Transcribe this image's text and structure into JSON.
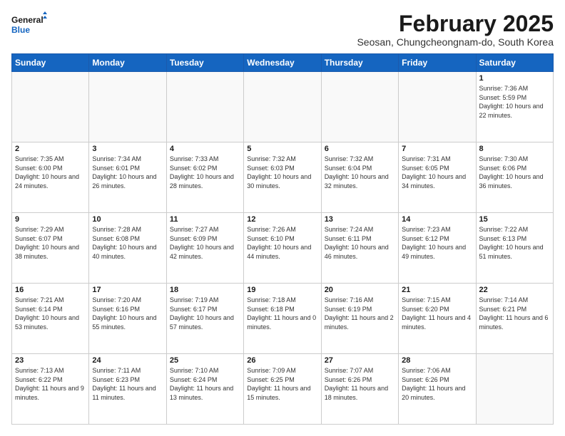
{
  "header": {
    "logo_line1": "General",
    "logo_line2": "Blue",
    "main_title": "February 2025",
    "subtitle": "Seosan, Chungcheongnam-do, South Korea"
  },
  "days_of_week": [
    "Sunday",
    "Monday",
    "Tuesday",
    "Wednesday",
    "Thursday",
    "Friday",
    "Saturday"
  ],
  "weeks": [
    [
      {
        "day": "",
        "info": ""
      },
      {
        "day": "",
        "info": ""
      },
      {
        "day": "",
        "info": ""
      },
      {
        "day": "",
        "info": ""
      },
      {
        "day": "",
        "info": ""
      },
      {
        "day": "",
        "info": ""
      },
      {
        "day": "1",
        "info": "Sunrise: 7:36 AM\nSunset: 5:59 PM\nDaylight: 10 hours and 22 minutes."
      }
    ],
    [
      {
        "day": "2",
        "info": "Sunrise: 7:35 AM\nSunset: 6:00 PM\nDaylight: 10 hours and 24 minutes."
      },
      {
        "day": "3",
        "info": "Sunrise: 7:34 AM\nSunset: 6:01 PM\nDaylight: 10 hours and 26 minutes."
      },
      {
        "day": "4",
        "info": "Sunrise: 7:33 AM\nSunset: 6:02 PM\nDaylight: 10 hours and 28 minutes."
      },
      {
        "day": "5",
        "info": "Sunrise: 7:32 AM\nSunset: 6:03 PM\nDaylight: 10 hours and 30 minutes."
      },
      {
        "day": "6",
        "info": "Sunrise: 7:32 AM\nSunset: 6:04 PM\nDaylight: 10 hours and 32 minutes."
      },
      {
        "day": "7",
        "info": "Sunrise: 7:31 AM\nSunset: 6:05 PM\nDaylight: 10 hours and 34 minutes."
      },
      {
        "day": "8",
        "info": "Sunrise: 7:30 AM\nSunset: 6:06 PM\nDaylight: 10 hours and 36 minutes."
      }
    ],
    [
      {
        "day": "9",
        "info": "Sunrise: 7:29 AM\nSunset: 6:07 PM\nDaylight: 10 hours and 38 minutes."
      },
      {
        "day": "10",
        "info": "Sunrise: 7:28 AM\nSunset: 6:08 PM\nDaylight: 10 hours and 40 minutes."
      },
      {
        "day": "11",
        "info": "Sunrise: 7:27 AM\nSunset: 6:09 PM\nDaylight: 10 hours and 42 minutes."
      },
      {
        "day": "12",
        "info": "Sunrise: 7:26 AM\nSunset: 6:10 PM\nDaylight: 10 hours and 44 minutes."
      },
      {
        "day": "13",
        "info": "Sunrise: 7:24 AM\nSunset: 6:11 PM\nDaylight: 10 hours and 46 minutes."
      },
      {
        "day": "14",
        "info": "Sunrise: 7:23 AM\nSunset: 6:12 PM\nDaylight: 10 hours and 49 minutes."
      },
      {
        "day": "15",
        "info": "Sunrise: 7:22 AM\nSunset: 6:13 PM\nDaylight: 10 hours and 51 minutes."
      }
    ],
    [
      {
        "day": "16",
        "info": "Sunrise: 7:21 AM\nSunset: 6:14 PM\nDaylight: 10 hours and 53 minutes."
      },
      {
        "day": "17",
        "info": "Sunrise: 7:20 AM\nSunset: 6:16 PM\nDaylight: 10 hours and 55 minutes."
      },
      {
        "day": "18",
        "info": "Sunrise: 7:19 AM\nSunset: 6:17 PM\nDaylight: 10 hours and 57 minutes."
      },
      {
        "day": "19",
        "info": "Sunrise: 7:18 AM\nSunset: 6:18 PM\nDaylight: 11 hours and 0 minutes."
      },
      {
        "day": "20",
        "info": "Sunrise: 7:16 AM\nSunset: 6:19 PM\nDaylight: 11 hours and 2 minutes."
      },
      {
        "day": "21",
        "info": "Sunrise: 7:15 AM\nSunset: 6:20 PM\nDaylight: 11 hours and 4 minutes."
      },
      {
        "day": "22",
        "info": "Sunrise: 7:14 AM\nSunset: 6:21 PM\nDaylight: 11 hours and 6 minutes."
      }
    ],
    [
      {
        "day": "23",
        "info": "Sunrise: 7:13 AM\nSunset: 6:22 PM\nDaylight: 11 hours and 9 minutes."
      },
      {
        "day": "24",
        "info": "Sunrise: 7:11 AM\nSunset: 6:23 PM\nDaylight: 11 hours and 11 minutes."
      },
      {
        "day": "25",
        "info": "Sunrise: 7:10 AM\nSunset: 6:24 PM\nDaylight: 11 hours and 13 minutes."
      },
      {
        "day": "26",
        "info": "Sunrise: 7:09 AM\nSunset: 6:25 PM\nDaylight: 11 hours and 15 minutes."
      },
      {
        "day": "27",
        "info": "Sunrise: 7:07 AM\nSunset: 6:26 PM\nDaylight: 11 hours and 18 minutes."
      },
      {
        "day": "28",
        "info": "Sunrise: 7:06 AM\nSunset: 6:26 PM\nDaylight: 11 hours and 20 minutes."
      },
      {
        "day": "",
        "info": ""
      }
    ]
  ]
}
